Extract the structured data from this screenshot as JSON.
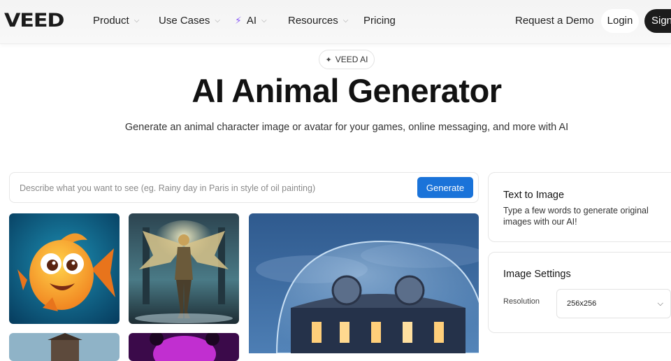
{
  "nav": {
    "logo": "VEED",
    "items": [
      {
        "label": "Product"
      },
      {
        "label": "Use Cases"
      },
      {
        "label": "AI"
      },
      {
        "label": "Resources"
      },
      {
        "label": "Pricing"
      }
    ],
    "demo": "Request a Demo",
    "login": "Login",
    "signup": "Sign"
  },
  "hero": {
    "badge": "VEED AI",
    "title": "AI Animal Generator",
    "subtitle": "Generate an animal character image or avatar for your games, online messaging, and more with AI"
  },
  "prompt": {
    "placeholder": "Describe what you want to see (eg. Rainy day in Paris in style of oil painting)",
    "button": "Generate"
  },
  "text_to_image": {
    "title": "Text to Image",
    "description": "Type a few words to generate original images with our AI!"
  },
  "image_settings": {
    "title": "Image Settings",
    "resolution_label": "Resolution",
    "resolution_value": "256x256"
  },
  "colors": {
    "primary": "#1a73d9",
    "ai_accent": "#8b5cf6",
    "dark": "#1c1c1c"
  }
}
